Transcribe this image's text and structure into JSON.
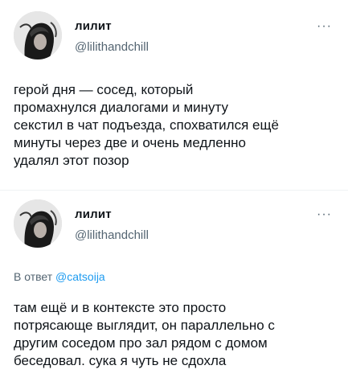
{
  "tweets": [
    {
      "display_name": "лилит",
      "handle": "@lilithandchill",
      "more_icon": "more-dots-icon",
      "text": "герой дня — сосед, который\nпромахнулся диалогами и минуту\nсекстил в чат подъезда, спохватился ещё\nминуты через две и очень медленно\nудалял этот позор"
    },
    {
      "display_name": "лилит",
      "handle": "@lilithandchill",
      "more_icon": "more-dots-icon",
      "reply_prefix": "В ответ",
      "reply_to": "@catsoija",
      "text": "там ещё и в контексте это просто\nпотрясающе выглядит, он параллельно с\nдругим соседом про зал рядом с домом\nбеседовал. сука я чуть не сдохла"
    }
  ],
  "colors": {
    "text": "#0f1419",
    "secondary": "#536471",
    "link": "#1d9bf0",
    "divider": "#eff3f4"
  }
}
